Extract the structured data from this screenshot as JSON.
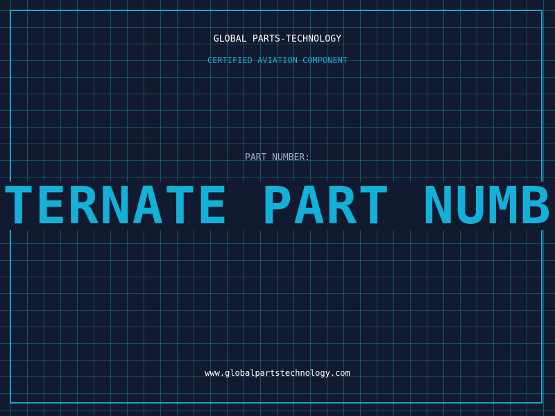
{
  "header": {
    "company": "GLOBAL PARTS-TECHNOLOGY",
    "subtitle": "CERTIFIED AVIATION COMPONENT"
  },
  "part": {
    "label": "PART NUMBER:",
    "value": "ALTERNATE PART NUMBER"
  },
  "footer": {
    "website": "www.globalpartstechnology.com"
  },
  "colors": {
    "background": "#111a2e",
    "grid": "#2096b0",
    "accent": "#19a7cf",
    "text_primary": "#ffffff",
    "text_muted": "#9fb0c8"
  }
}
